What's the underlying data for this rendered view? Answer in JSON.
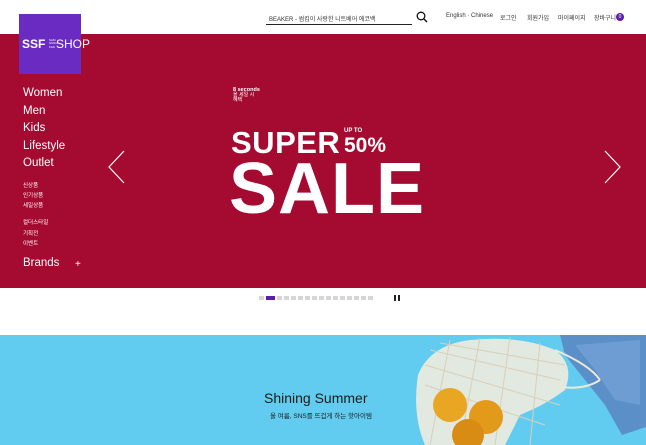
{
  "header": {
    "search_value": "BEAKER - 썸킵이 사랑한 니트베어 에코백",
    "utility_links": [
      "English · Chinese",
      "로그인",
      "회원가입",
      "마이페이지",
      "장바구니"
    ],
    "cart_count": "0"
  },
  "logo": {
    "ssf": "SSF",
    "small_lines": [
      "SAM",
      "SUNG",
      "F&S"
    ],
    "shop": "SHOP"
  },
  "nav": {
    "main": [
      "Women",
      "Men",
      "Kids",
      "Lifestyle",
      "Outlet"
    ],
    "sub1": [
      "신상품",
      "인기상품",
      "세일상품"
    ],
    "sub2": [
      "컬더스타일",
      "기획전",
      "이벤트"
    ],
    "brands": "Brands",
    "brands_toggle": "+"
  },
  "hero": {
    "tag_lines": [
      "8 seconds",
      "올 세일 시",
      "혜택"
    ],
    "super": "SUPER",
    "up_to": "UP TO",
    "percent": "50%",
    "sale": "SALE",
    "background": "#a50a30"
  },
  "pagination": {
    "total": 16,
    "active_index": 1
  },
  "banner2": {
    "title": "Shining Summer",
    "subtitle": "올 여름, SNS를 뜨겁게 하는 핫아이템",
    "background": "#62ccf0"
  },
  "colors": {
    "brand": "#6a2bc2",
    "accent": "#5a1ea8"
  }
}
